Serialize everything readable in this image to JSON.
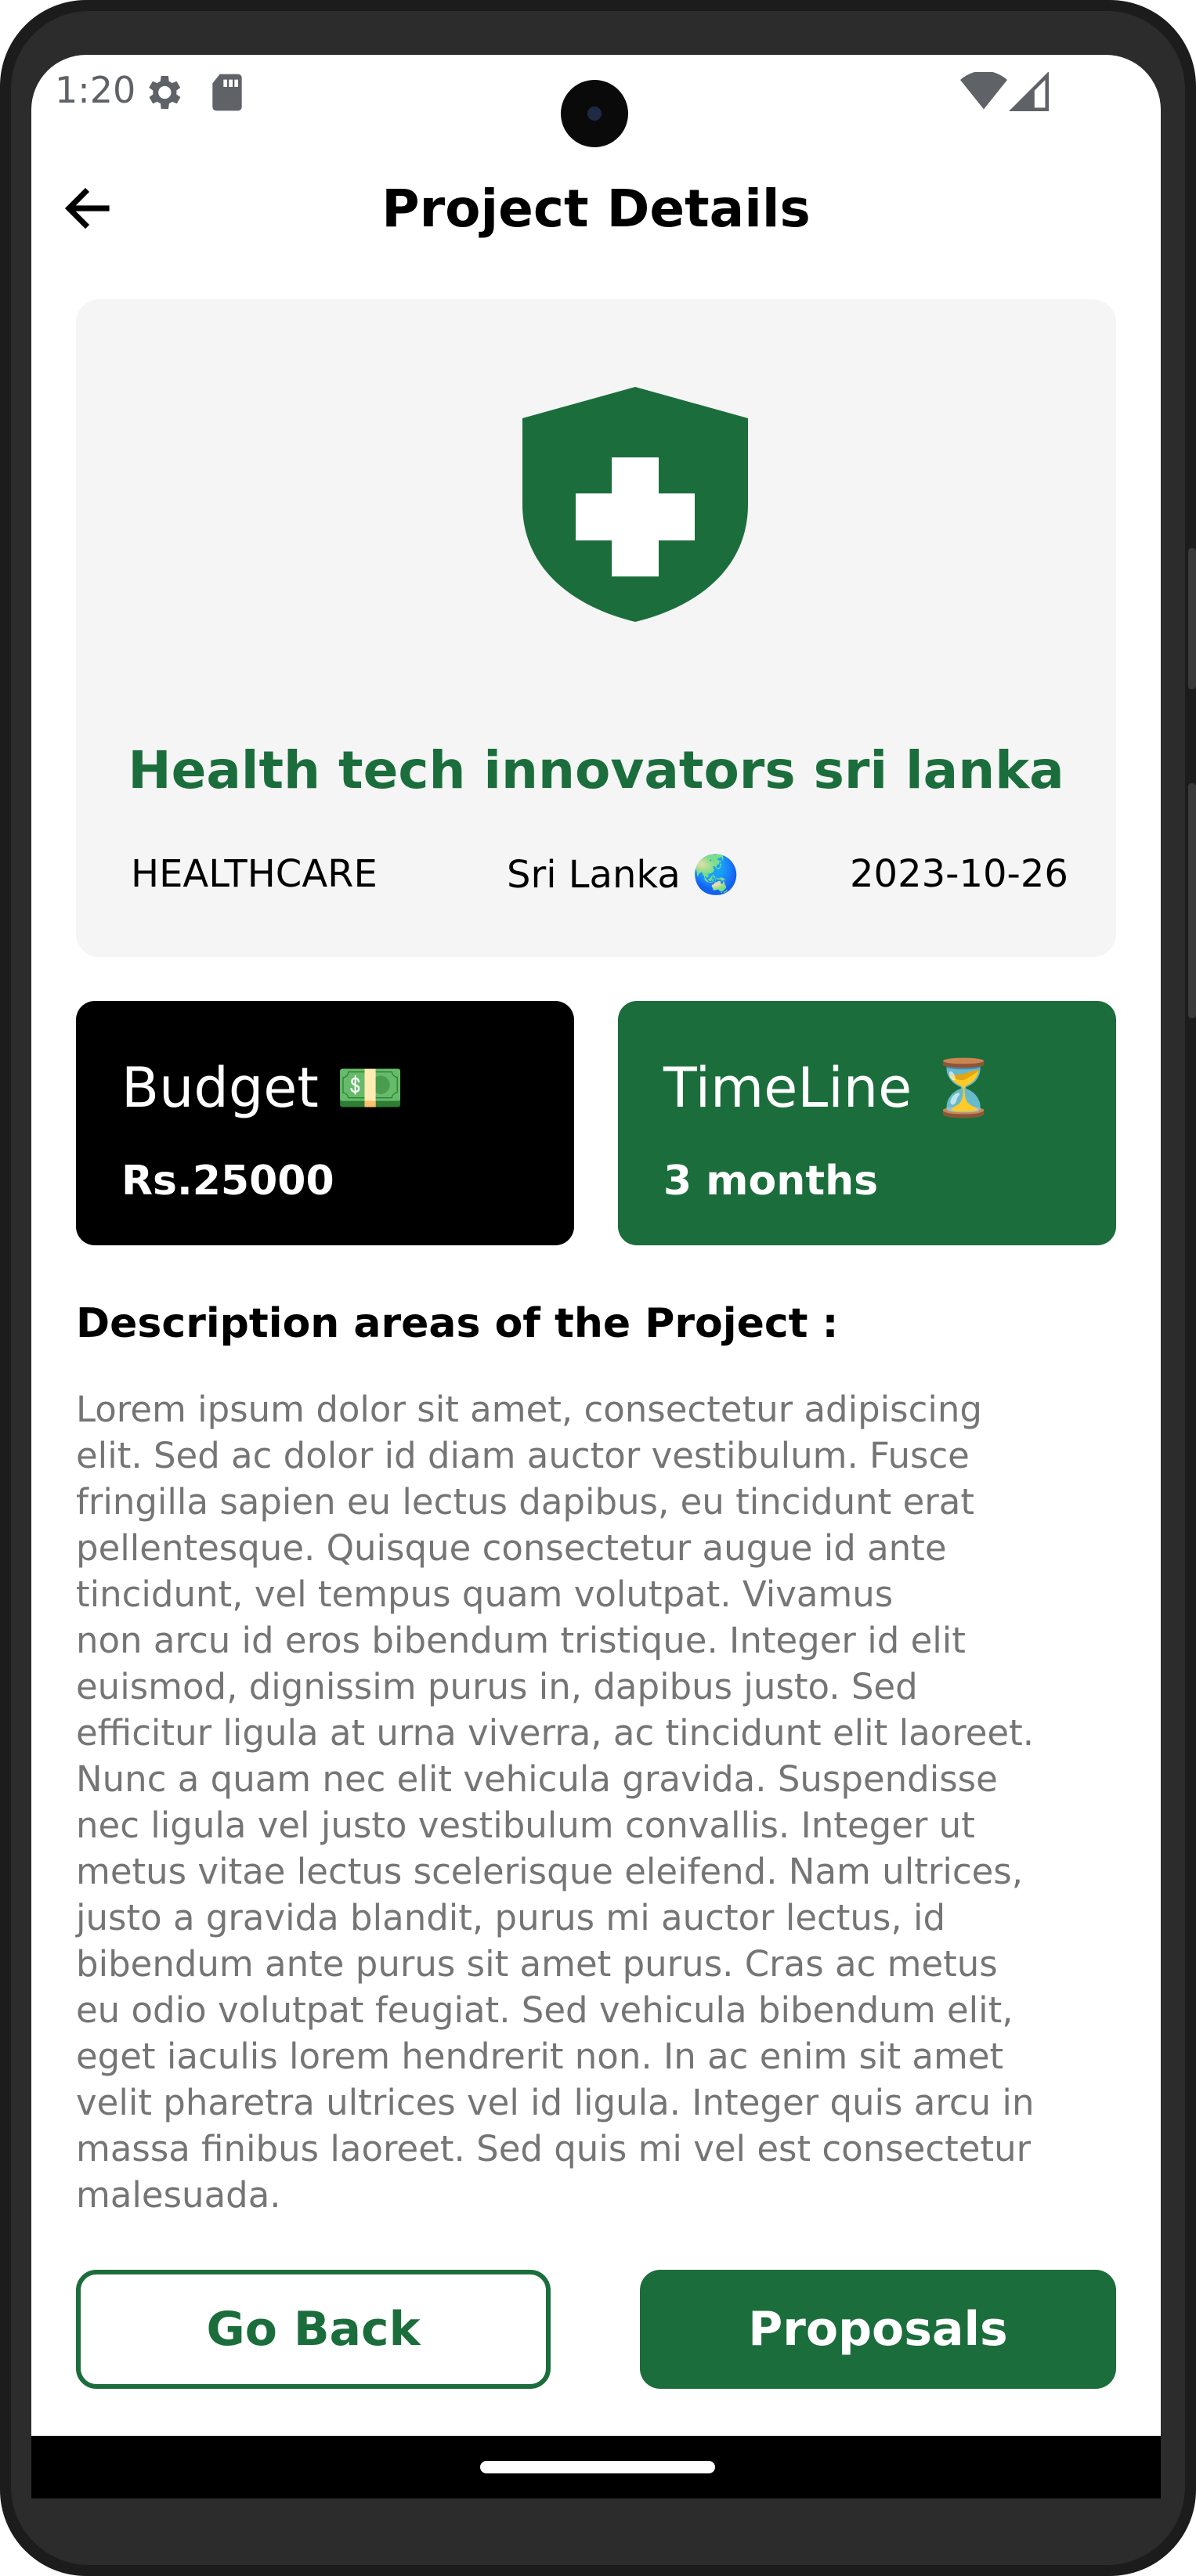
{
  "status_bar": {
    "time": "1:20",
    "icons": [
      "settings-gear-icon",
      "sd-card-icon",
      "wifi-icon",
      "signal-icon"
    ]
  },
  "header": {
    "title": "Project Details",
    "back_icon": "arrow-left-icon"
  },
  "project": {
    "icon": "shield-cross-icon",
    "name": "Health tech innovators sri lanka",
    "category": "HEALTHCARE",
    "location": "Sri Lanka 🌏",
    "date": "2023-10-26"
  },
  "budget": {
    "title": "Budget 💵",
    "value": "Rs.25000"
  },
  "timeline": {
    "title": "TimeLine ⏳",
    "value": "3 months"
  },
  "description": {
    "heading": "Description areas of the Project :",
    "body": "Lorem ipsum dolor sit amet, consectetur adipiscing\nelit. Sed ac dolor id diam auctor vestibulum. Fusce\nfringilla sapien eu lectus dapibus, eu tincidunt erat\npellentesque. Quisque consectetur augue id ante\ntincidunt, vel tempus quam volutpat. Vivamus\nnon arcu id eros bibendum tristique. Integer id elit\neuismod, dignissim purus in, dapibus justo. Sed\nefficitur ligula at urna viverra, ac tincidunt elit laoreet.\nNunc a quam nec elit vehicula gravida. Suspendisse\nnec ligula vel justo vestibulum convallis. Integer ut\nmetus vitae lectus scelerisque eleifend. Nam ultrices,\njusto a gravida blandit, purus mi auctor lectus, id\nbibendum ante purus sit amet purus. Cras ac metus\neu odio volutpat feugiat. Sed vehicula bibendum elit,\neget iaculis lorem hendrerit non. In ac enim sit amet\nvelit pharetra ultrices vel id ligula. Integer quis arcu in\nmassa finibus laoreet. Sed quis mi vel est consectetur\nmalesuada."
  },
  "actions": {
    "go_back": "Go Back",
    "proposals": "Proposals"
  },
  "colors": {
    "brand_green": "#1b6e3c",
    "budget_card": "#000000",
    "hero_bg": "#f5f5f5",
    "body_text": "#757575"
  }
}
